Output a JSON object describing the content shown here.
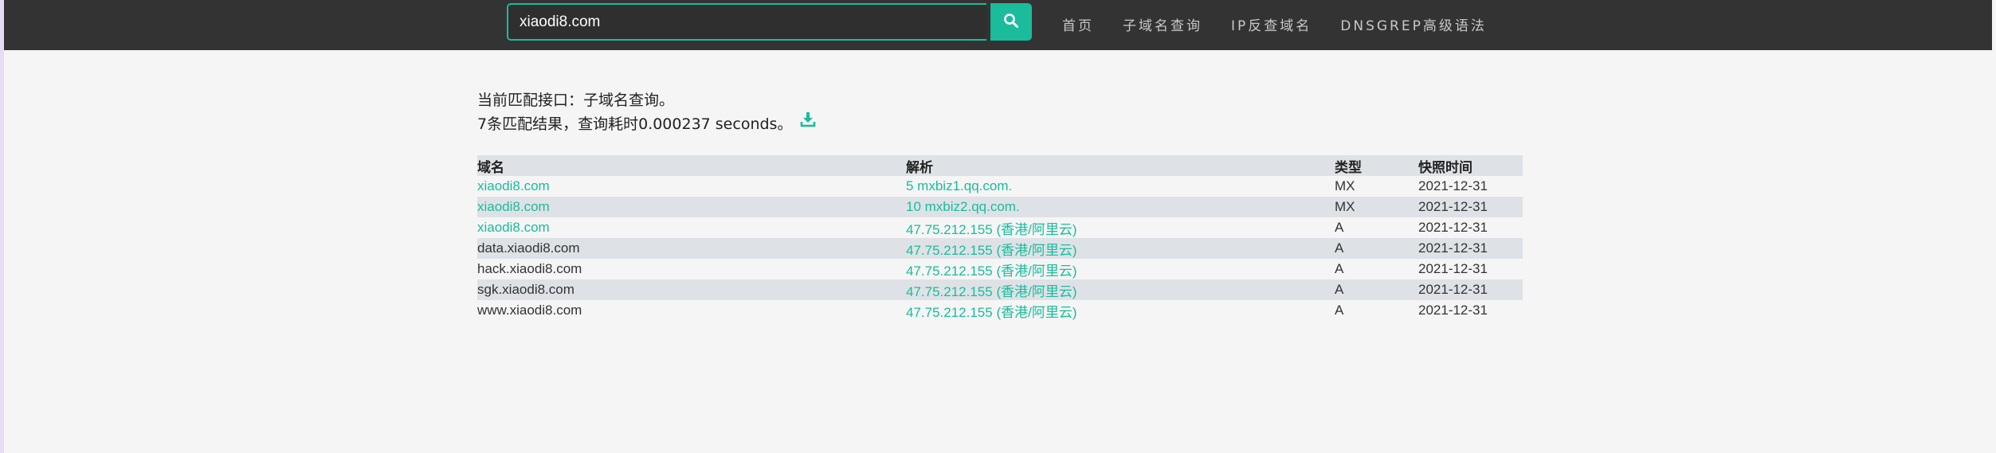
{
  "search": {
    "value": "xiaodi8.com",
    "button_icon": "search-icon"
  },
  "nav": {
    "items": [
      {
        "label": "首页"
      },
      {
        "label": "子域名查询"
      },
      {
        "label": "IP反查域名"
      },
      {
        "label": "DNSGREP高级语法"
      }
    ]
  },
  "info": {
    "interface_line": "当前匹配接口：子域名查询。",
    "result_line": "7条匹配结果，查询耗时0.000237 seconds。",
    "download_icon": "download-icon"
  },
  "table": {
    "headers": {
      "domain": "域名",
      "resolve": "解析",
      "type": "类型",
      "time": "快照时间"
    },
    "rows": [
      {
        "domain": "xiaodi8.com",
        "resolve": "5 mxbiz1.qq.com.",
        "type": "MX",
        "time": "2021-12-31"
      },
      {
        "domain": "xiaodi8.com",
        "resolve": "10 mxbiz2.qq.com.",
        "type": "MX",
        "time": "2021-12-31"
      },
      {
        "domain": "xiaodi8.com",
        "resolve": "47.75.212.155 (香港/阿里云)",
        "type": "A",
        "time": "2021-12-31"
      },
      {
        "domain": "data.xiaodi8.com",
        "resolve": "47.75.212.155 (香港/阿里云)",
        "type": "A",
        "time": "2021-12-31"
      },
      {
        "domain": "hack.xiaodi8.com",
        "resolve": "47.75.212.155 (香港/阿里云)",
        "type": "A",
        "time": "2021-12-31"
      },
      {
        "domain": "sgk.xiaodi8.com",
        "resolve": "47.75.212.155 (香港/阿里云)",
        "type": "A",
        "time": "2021-12-31"
      },
      {
        "domain": "www.xiaodi8.com",
        "resolve": "47.75.212.155 (香港/阿里云)",
        "type": "A",
        "time": "2021-12-31"
      }
    ]
  },
  "colors": {
    "accent": "#1abc9c",
    "navbar": "#333333",
    "page_bg": "#f5f5f5",
    "row_stripe": "#dee2e6"
  }
}
